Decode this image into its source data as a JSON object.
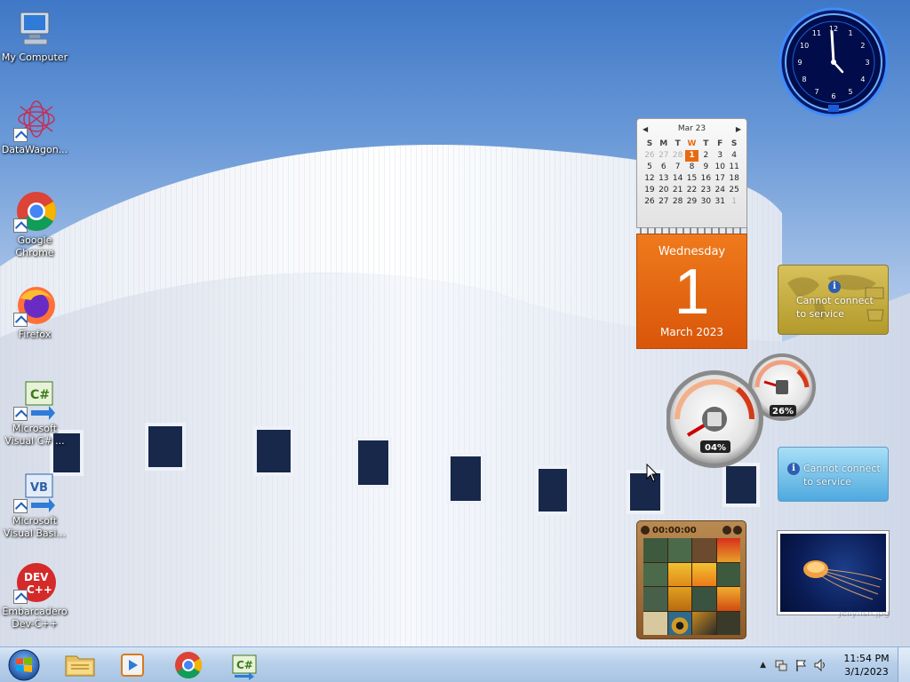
{
  "desktop_icons": [
    {
      "id": "my-computer",
      "label": "My Computer"
    },
    {
      "id": "datawagon",
      "label": "DataWagon..."
    },
    {
      "id": "google-chrome",
      "label": "Google Chrome"
    },
    {
      "id": "firefox",
      "label": "Firefox"
    },
    {
      "id": "visual-csharp",
      "label": "Microsoft Visual C# ..."
    },
    {
      "id": "visual-basic",
      "label": "Microsoft Visual Basi..."
    },
    {
      "id": "devcpp",
      "label": "Embarcadero Dev-C++"
    }
  ],
  "clock_gadget": {
    "numerals": [
      "12",
      "1",
      "2",
      "3",
      "4",
      "5",
      "6",
      "7",
      "8",
      "9",
      "10",
      "11"
    ],
    "accent": "#1e74ff"
  },
  "calendar_gadget": {
    "month_label": "Mar 23",
    "weekday_headers": [
      "S",
      "M",
      "T",
      "W",
      "T",
      "F",
      "S"
    ],
    "weeks": [
      [
        "26",
        "27",
        "28",
        "1",
        "2",
        "3",
        "4"
      ],
      [
        "5",
        "6",
        "7",
        "8",
        "9",
        "10",
        "11"
      ],
      [
        "12",
        "13",
        "14",
        "15",
        "16",
        "17",
        "18"
      ],
      [
        "19",
        "20",
        "21",
        "22",
        "23",
        "24",
        "25"
      ],
      [
        "26",
        "27",
        "28",
        "29",
        "30",
        "31",
        "1"
      ]
    ],
    "today": "1",
    "day_of_week": "Wednesday",
    "day_number": "1",
    "month_year": "March 2023",
    "accent": "#e86a10"
  },
  "weather_gadget_1": {
    "message_line1": "Cannot connect",
    "message_line2": "to service"
  },
  "weather_gadget_2": {
    "message_line1": "Cannot connect",
    "message_line2": "to service"
  },
  "cpu_meter": {
    "cpu_percent": "04%",
    "memory_percent": "26%"
  },
  "puzzle_gadget": {
    "timer": "00:00:00"
  },
  "slideshow_gadget": {
    "caption": "Jellyfish.jpg"
  },
  "taskbar": {
    "pinned": [
      {
        "id": "windows-explorer",
        "icon": "folder-icon"
      },
      {
        "id": "media-player",
        "icon": "media-player-icon"
      },
      {
        "id": "chrome",
        "icon": "chrome-icon"
      },
      {
        "id": "visual-csharp",
        "icon": "csharp-icon"
      }
    ],
    "time": "11:54 PM",
    "date": "3/1/2023"
  }
}
